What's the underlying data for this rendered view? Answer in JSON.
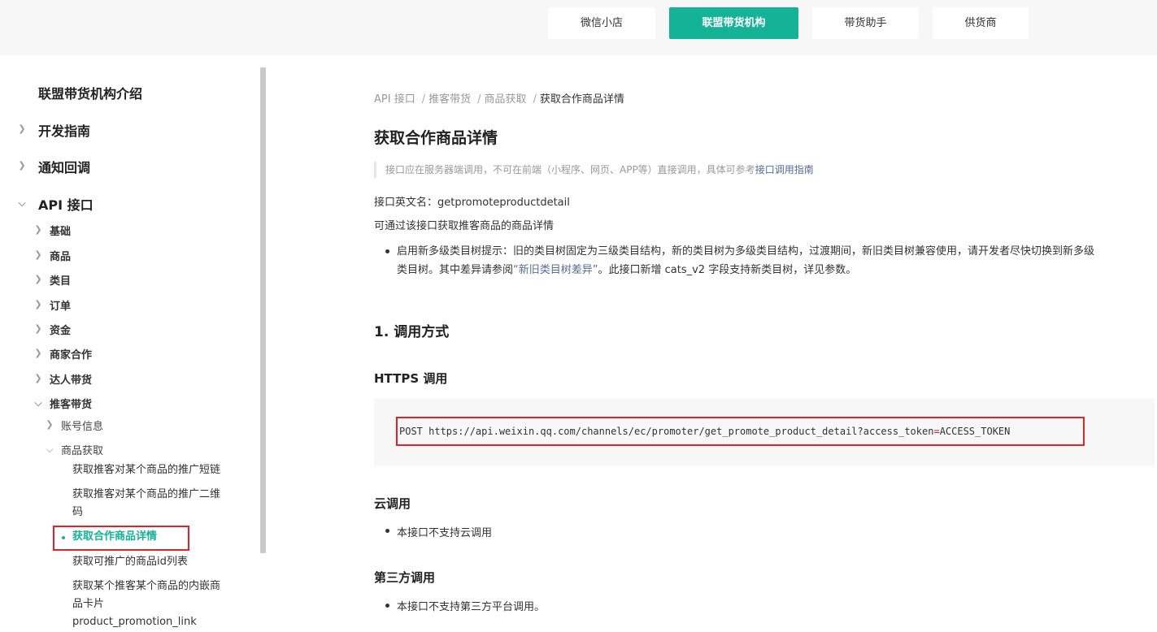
{
  "top_tabs": [
    {
      "label": "微信小店"
    },
    {
      "label": "联盟带货机构"
    },
    {
      "label": "带货助手"
    },
    {
      "label": "供货商"
    }
  ],
  "sidebar": {
    "intro": "联盟带货机构介绍",
    "dev_guide": "开发指南",
    "notify": "通知回调",
    "api": "API 接口",
    "api_children": [
      "基础",
      "商品",
      "类目",
      "订单",
      "资金",
      "商家合作",
      "达人带货",
      "推客带货"
    ],
    "promoter_children": [
      "账号信息",
      "商品获取"
    ],
    "goods_children": [
      "获取推客对某个商品的推广短链",
      "获取推客对某个商品的推广二维",
      "码",
      "获取合作商品详情",
      "获取可推广的商品id列表",
      "获取某个推客某个商品的内嵌商",
      "品卡片",
      "product_promotion_link"
    ]
  },
  "breadcrumb": [
    "API 接口",
    "推客带货",
    "商品获取",
    "获取合作商品详情"
  ],
  "page": {
    "title": "获取合作商品详情",
    "notice_text": "接口应在服务器端调用，不可在前端（小程序、网页、APP等）直接调用，具体可参考",
    "notice_link": "接口调用指南",
    "api_name": "接口英文名：getpromoteproductdetail",
    "desc": "可通过该接口获取推客商品的商品详情",
    "tip_line1": "启用新多级类目树提示：旧的类目树固定为三级类目结构，新的类目树为多级类目结构，过渡期间，新旧类目树兼容使用，请开发者尽快切换到新多级",
    "tip_line2_a": "类目树。其中差异请参阅",
    "tip_link": "“新旧类目树差异”",
    "tip_line2_b": "。此接口新增 cats_v2 字段支持新类目树，详见参数。",
    "section1": "1. 调用方式",
    "https_title": "HTTPS 调用",
    "code_a": "POST https://api.weixin.qq.com/channels/ec/promoter/get_promote_product_detail?access_token",
    "code_eq": "=",
    "code_b": "ACCESS_TOKEN",
    "cloud_title": "云调用",
    "cloud_item": "本接口不支持云调用",
    "third_title": "第三方调用",
    "third_item": "本接口不支持第三方平台调用。"
  },
  "colors": {
    "accent": "#14b297",
    "highlight_box": "#e0222b",
    "link": "#576b95"
  },
  "icons": {
    "collapsed": "chevron-right-icon",
    "expanded": "chevron-down-icon"
  }
}
